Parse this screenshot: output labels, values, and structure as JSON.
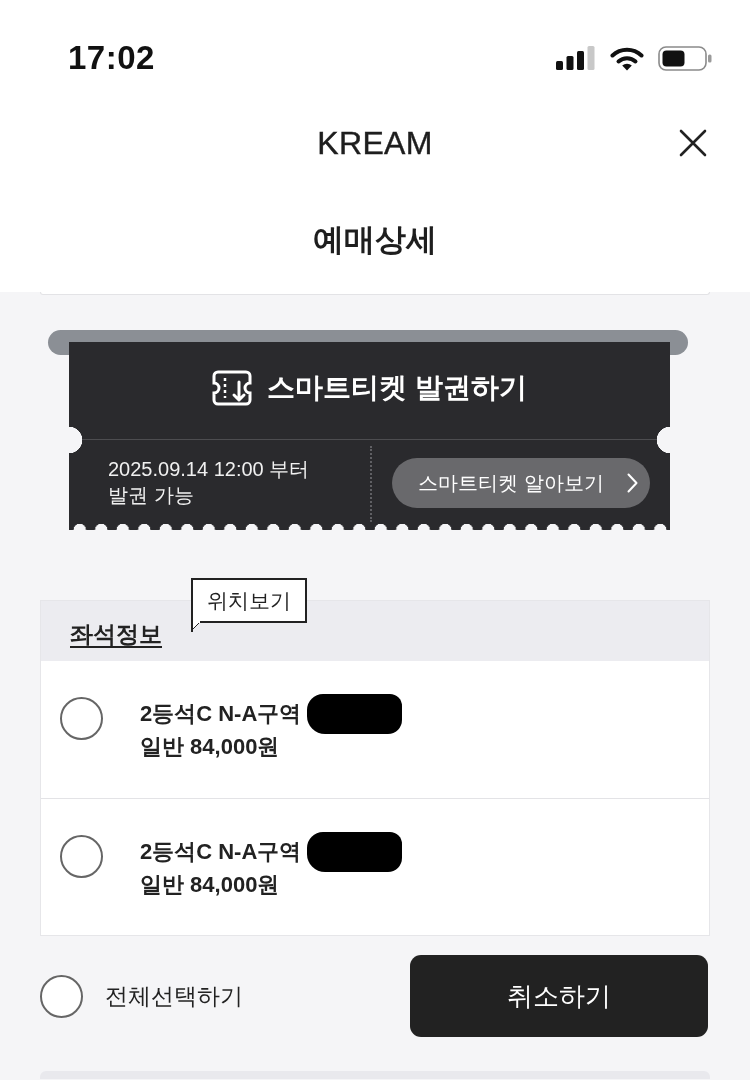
{
  "status_bar": {
    "time": "17:02"
  },
  "nav": {
    "brand": "KREAM"
  },
  "page_title": "예매상세",
  "smart_ticket": {
    "title": "스마트티켓 발권하기",
    "issue_note": "2025.09.14 12:00 부터\n발권 가능",
    "info_button": "스마트티켓 알아보기"
  },
  "seat_section": {
    "heading": "좌석정보",
    "tooltip": "위치보기",
    "seats": [
      {
        "name": "2등석C N-A구역",
        "redacted": true,
        "price": "일반 84,000원",
        "selected": false
      },
      {
        "name": "2등석C N-A구역",
        "redacted": true,
        "price": "일반 84,000원",
        "selected": false
      }
    ]
  },
  "select_all": {
    "label": "전체선택하기",
    "selected": false
  },
  "cancel_button": "취소하기"
}
